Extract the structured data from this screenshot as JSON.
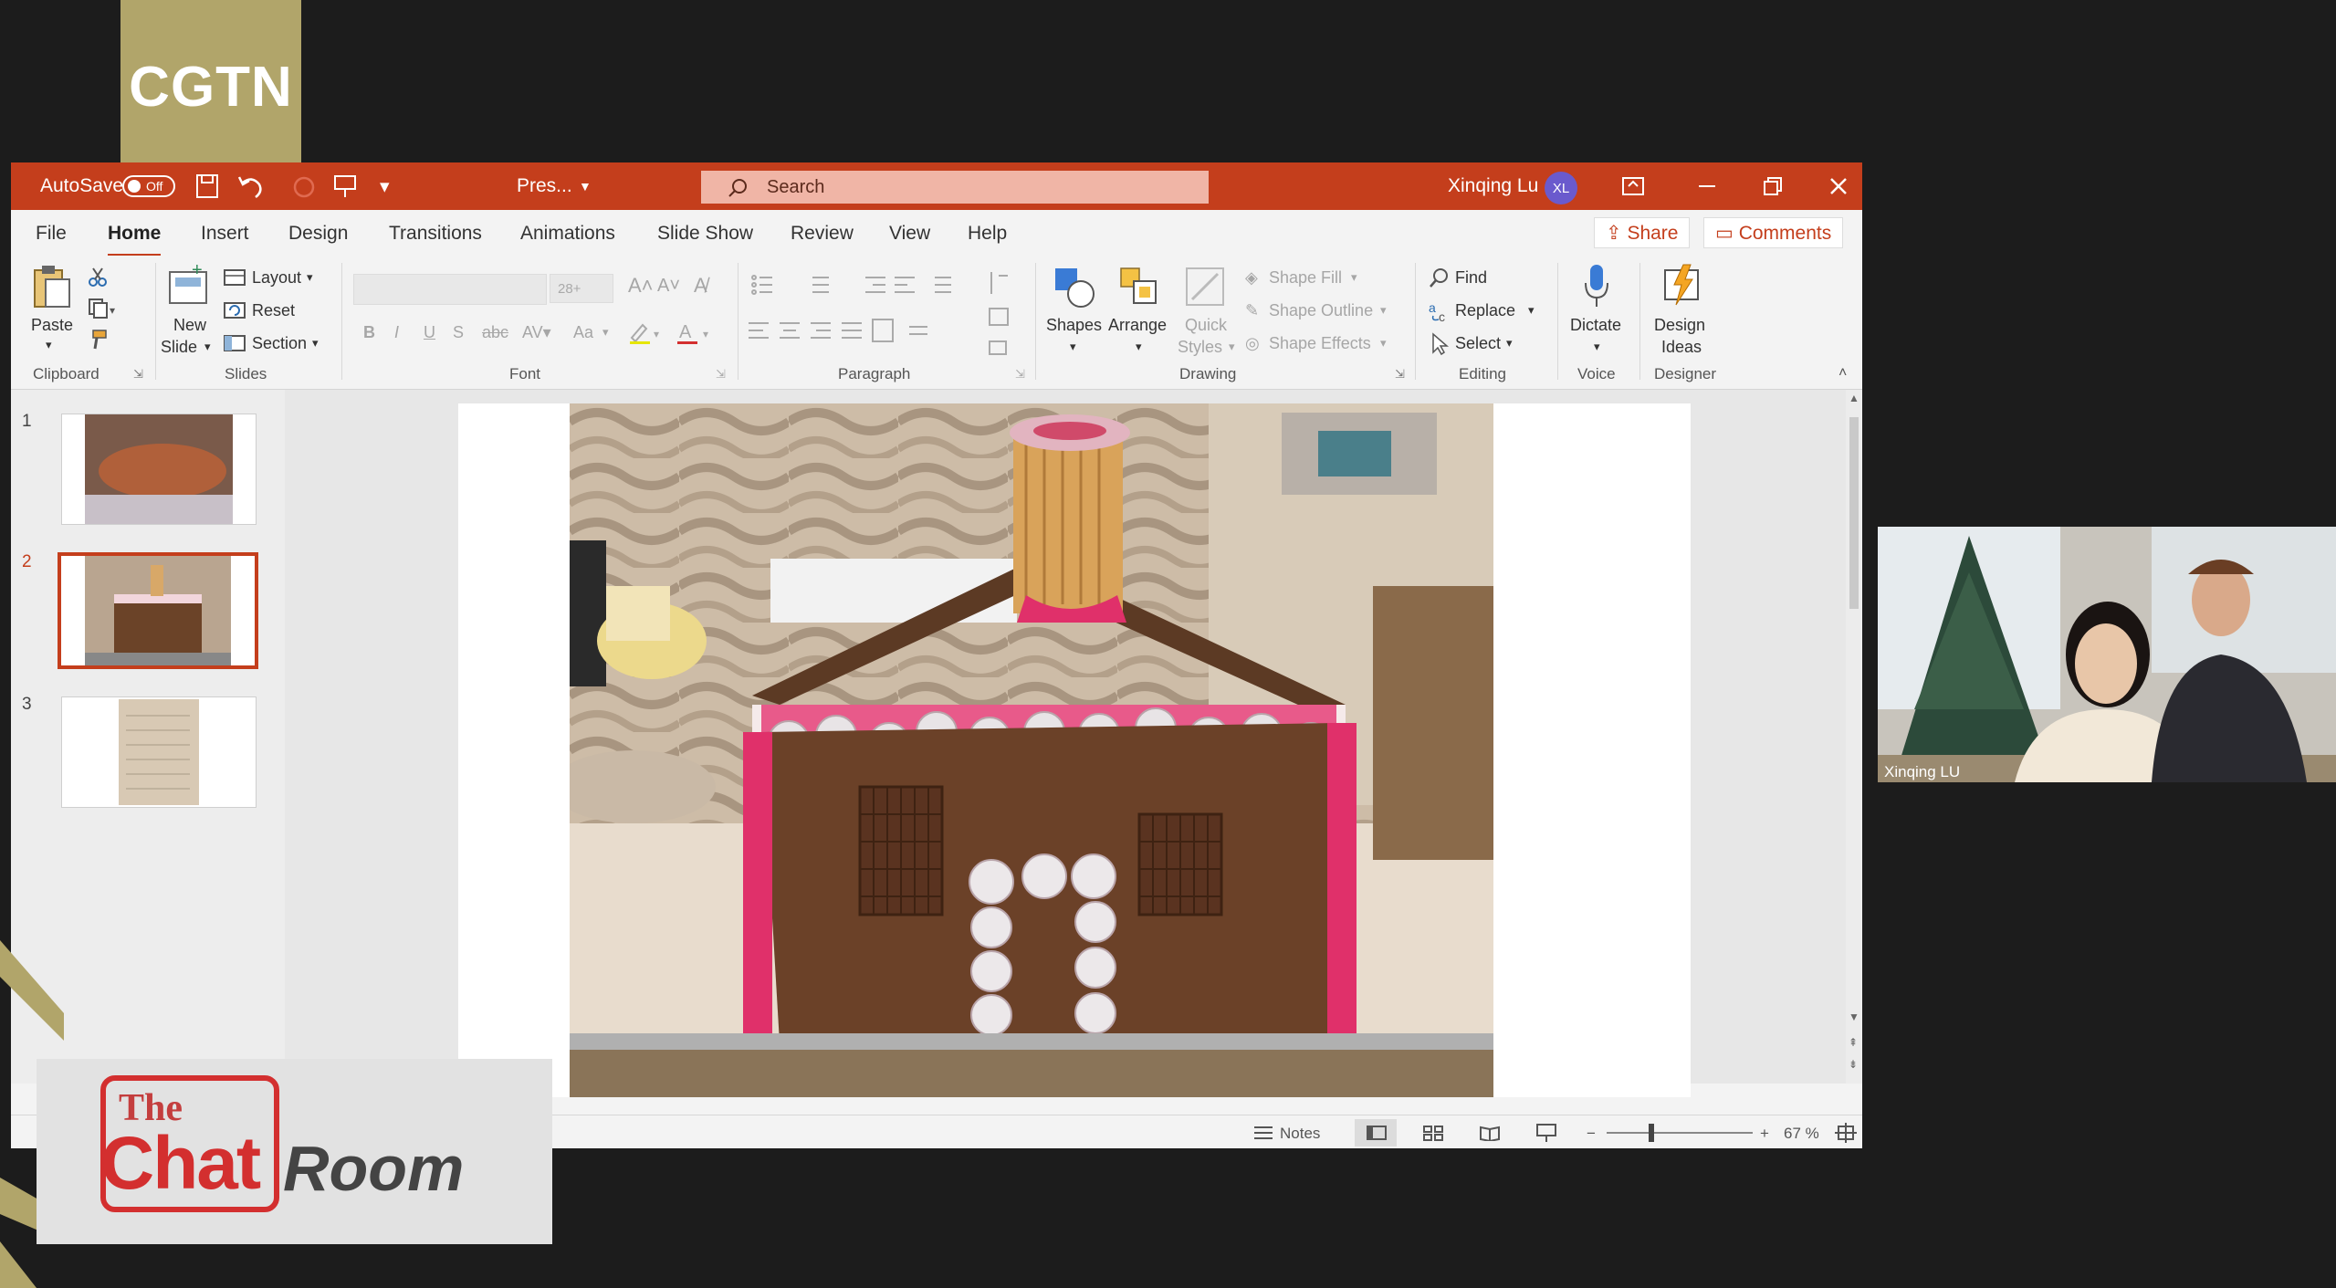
{
  "overlay": {
    "brand_logo": "CGTN",
    "show_logo": {
      "the": "The",
      "chat": "Chat",
      "room": "Room"
    }
  },
  "titlebar": {
    "autosave_label": "AutoSave",
    "autosave_state": "Off",
    "file_name": "Pres...",
    "search_placeholder": "Search",
    "user_name": "Xinqing Lu",
    "user_initials": "XL"
  },
  "menu": {
    "tabs": [
      "File",
      "Home",
      "Insert",
      "Design",
      "Transitions",
      "Animations",
      "Slide Show",
      "Review",
      "View",
      "Help"
    ],
    "active_tab": "Home",
    "share_label": "Share",
    "comments_label": "Comments"
  },
  "ribbon": {
    "clipboard": {
      "paste": "Paste",
      "group": "Clipboard"
    },
    "slides": {
      "new_slide_1": "New",
      "new_slide_2": "Slide",
      "layout": "Layout",
      "reset": "Reset",
      "section": "Section",
      "group": "Slides"
    },
    "font": {
      "size": "28+",
      "group": "Font",
      "bold": "B",
      "italic": "I",
      "underline": "U",
      "strike": "S",
      "change_case": "Aa"
    },
    "paragraph": {
      "group": "Paragraph"
    },
    "drawing": {
      "shapes": "Shapes",
      "arrange": "Arrange",
      "quick_1": "Quick",
      "quick_2": "Styles",
      "shape_fill": "Shape Fill",
      "shape_outline": "Shape Outline",
      "shape_effects": "Shape Effects",
      "group": "Drawing"
    },
    "editing": {
      "find": "Find",
      "replace": "Replace",
      "select": "Select",
      "group": "Editing"
    },
    "voice": {
      "dictate": "Dictate",
      "group": "Voice"
    },
    "designer": {
      "design_1": "Design",
      "design_2": "Ideas",
      "group": "Designer"
    }
  },
  "thumbnails": [
    {
      "number": "1",
      "selected": false
    },
    {
      "number": "2",
      "selected": true
    },
    {
      "number": "3",
      "selected": false
    }
  ],
  "statusbar": {
    "notes": "Notes",
    "zoom": "67 %"
  },
  "video": {
    "participant": "Xinqing LU"
  },
  "colors": {
    "ppt_accent": "#c43e1c",
    "cgtn_gold": "#b1a56a",
    "chat_red": "#d32f2f"
  }
}
